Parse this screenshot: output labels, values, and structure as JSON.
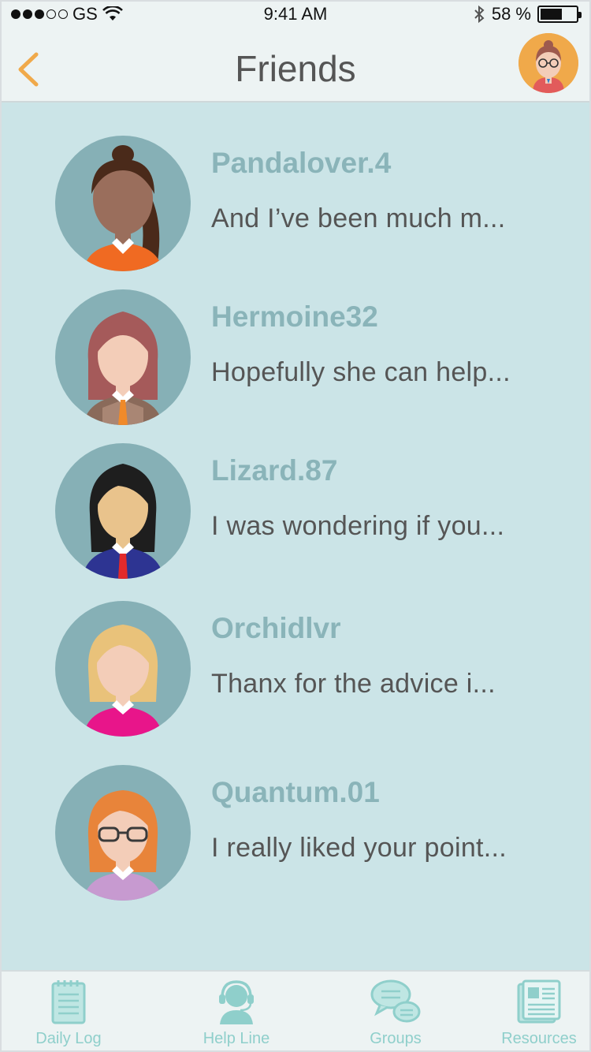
{
  "status_bar": {
    "carrier": "GS",
    "time": "9:41 AM",
    "battery": "58 %",
    "signal_bars_filled": 3,
    "signal_bars_total": 5
  },
  "nav": {
    "title": "Friends",
    "back_icon": "chevron-left-icon",
    "profile_icon": "user-avatar-icon"
  },
  "friends": [
    {
      "name": "Pandalover.4",
      "message": "And I’ve been much m...",
      "avatar": "woman-dark-ponytail"
    },
    {
      "name": "Hermoine32",
      "message": "Hopefully she can help...",
      "avatar": "woman-auburn-hair"
    },
    {
      "name": "Lizard.87",
      "message": "I was wondering if you...",
      "avatar": "woman-black-hair"
    },
    {
      "name": "Orchidlvr",
      "message": "Thanx for the advice i...",
      "avatar": "woman-blonde-hair"
    },
    {
      "name": "Quantum.01",
      "message": "I really liked your point...",
      "avatar": "woman-orange-hair-glasses"
    }
  ],
  "tabs": [
    {
      "label": "Daily Log",
      "icon": "notepad-icon"
    },
    {
      "label": "Help Line",
      "icon": "headset-icon"
    },
    {
      "label": "Groups",
      "icon": "chat-bubbles-icon"
    },
    {
      "label": "Resources",
      "icon": "newspaper-icon"
    }
  ],
  "colors": {
    "accent_orange": "#f0a94a",
    "content_bg": "#cbe4e7",
    "name_color": "#8ab4b9",
    "tab_label": "#8fcfcb"
  }
}
